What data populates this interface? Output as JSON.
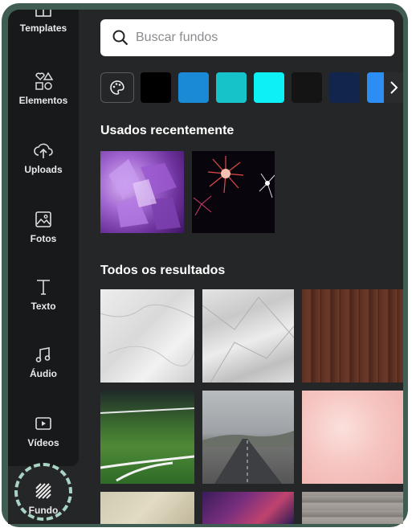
{
  "sidebar": {
    "items": [
      {
        "label": "Templates",
        "icon": "templates-icon"
      },
      {
        "label": "Elementos",
        "icon": "elements-icon"
      },
      {
        "label": "Uploads",
        "icon": "cloud-upload-icon"
      },
      {
        "label": "Fotos",
        "icon": "photo-icon"
      },
      {
        "label": "Texto",
        "icon": "text-icon"
      },
      {
        "label": "Áudio",
        "icon": "music-note-icon"
      },
      {
        "label": "Vídeos",
        "icon": "video-icon"
      }
    ],
    "active": {
      "label": "Fundo",
      "icon": "background-pattern-icon"
    }
  },
  "search": {
    "placeholder": "Buscar fundos"
  },
  "colors": {
    "swatches": [
      "#000000",
      "#1b8ad6",
      "#16c3c8",
      "#0ef1f4",
      "#141414",
      "#12254d",
      "#2c8ef5"
    ],
    "highlight_ring": "#a9d4c4",
    "frame": "#3f5d52"
  },
  "sections": {
    "recent_title": "Usados recentemente",
    "all_title": "Todos os resultados"
  },
  "recent": [
    {
      "name": "amethyst-crystals"
    },
    {
      "name": "fireworks"
    }
  ],
  "results": [
    {
      "name": "white-marble"
    },
    {
      "name": "crumpled-paper"
    },
    {
      "name": "dark-wood"
    },
    {
      "name": "soccer-field"
    },
    {
      "name": "foggy-road"
    },
    {
      "name": "pink-watercolor"
    },
    {
      "name": "old-map"
    },
    {
      "name": "galaxy"
    },
    {
      "name": "brick-wall"
    }
  ]
}
